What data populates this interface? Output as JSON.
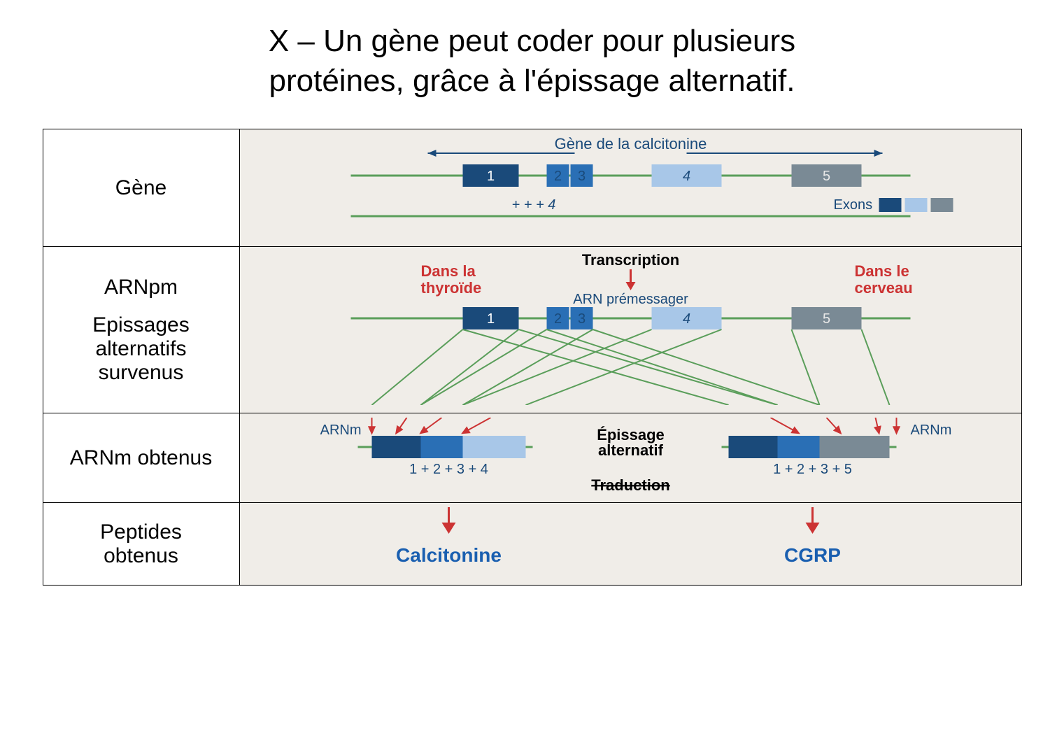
{
  "title_line1": "X – Un gène peut coder pour plusieurs",
  "title_line2": "protéines, grâce à l'épissage alternatif.",
  "row_labels": {
    "gene": "Gène",
    "arnpm": "ARNpm",
    "epissage1": "Epissages",
    "epissage2": "alternatifs",
    "epissage3": "survenus",
    "arnm_obt": "ARNm obtenus",
    "peptides1": "Peptides",
    "peptides2": "obtenus"
  },
  "diagram": {
    "gene_title": "Gène de la calcitonine",
    "exons_legend": "Exons",
    "plus4": "+ + + 4",
    "exon1": "1",
    "exon2": "2",
    "exon3": "3",
    "exon4": "4",
    "exon5": "5",
    "transcription": "Transcription",
    "dans_la": "Dans la",
    "thyroide": "thyroïde",
    "dans_le": "Dans le",
    "cerveau": "cerveau",
    "arn_pre": "ARN prémessager",
    "arnm_left": "ARNm",
    "arnm_right": "ARNm",
    "epissage_alt1": "Épissage",
    "epissage_alt2": "alternatif",
    "formula_left": "1 + 2 + 3 + 4",
    "formula_right": "1 + 2 + 3 + 5",
    "traduction": "Traduction",
    "calcitonine": "Calcitonine",
    "cgrp": "CGRP"
  },
  "colors": {
    "exon1_dark": "#1a4a7a",
    "exon23_blue": "#2a6fb5",
    "exon4_light": "#a8c7e8",
    "exon5_gray": "#7a8a95",
    "line_green": "#5a9e5a",
    "text_red": "#cc3333",
    "text_blue": "#1a5fb0"
  }
}
